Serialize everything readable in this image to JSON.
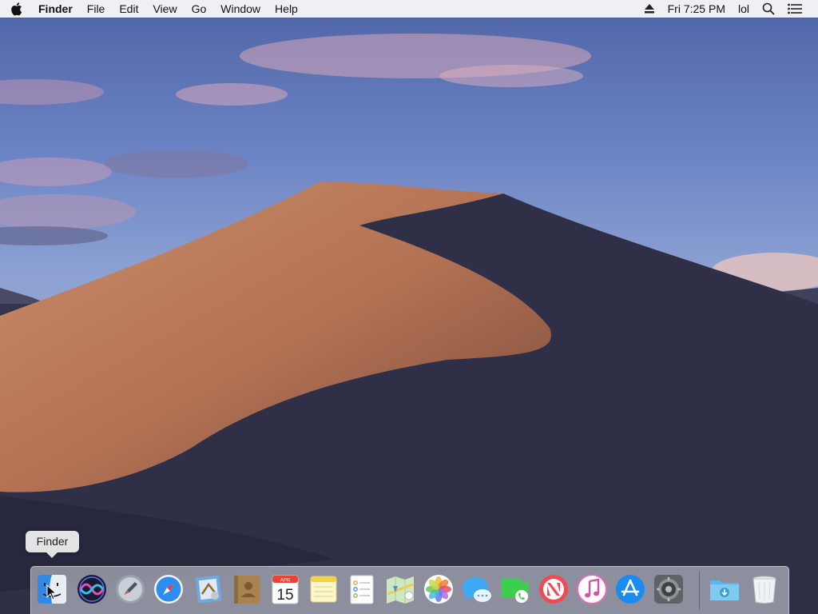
{
  "menubar": {
    "app_name": "Finder",
    "menus": [
      "File",
      "Edit",
      "View",
      "Go",
      "Window",
      "Help"
    ],
    "clock": "Fri 7:25 PM",
    "user": "lol"
  },
  "tooltip": {
    "text": "Finder"
  },
  "calendar": {
    "month": "APR",
    "day": "15"
  },
  "dock": {
    "items": [
      {
        "name": "finder",
        "icon": "finder-icon",
        "running": true
      },
      {
        "name": "siri",
        "icon": "siri-icon"
      },
      {
        "name": "launchpad",
        "icon": "launchpad-icon"
      },
      {
        "name": "safari",
        "icon": "safari-icon"
      },
      {
        "name": "mail",
        "icon": "mail-icon"
      },
      {
        "name": "contacts",
        "icon": "contacts-icon"
      },
      {
        "name": "calendar",
        "icon": "calendar-icon"
      },
      {
        "name": "notes",
        "icon": "notes-icon"
      },
      {
        "name": "reminders",
        "icon": "reminders-icon"
      },
      {
        "name": "maps",
        "icon": "maps-icon"
      },
      {
        "name": "photos",
        "icon": "photos-icon"
      },
      {
        "name": "messages",
        "icon": "messages-icon"
      },
      {
        "name": "facetime",
        "icon": "facetime-icon"
      },
      {
        "name": "news",
        "icon": "news-icon"
      },
      {
        "name": "itunes",
        "icon": "itunes-icon"
      },
      {
        "name": "app-store",
        "icon": "app-store-icon"
      },
      {
        "name": "system-preferences",
        "icon": "system-preferences-icon"
      },
      {
        "name": "downloads",
        "icon": "downloads-folder-icon"
      },
      {
        "name": "trash",
        "icon": "trash-icon"
      }
    ]
  },
  "colors": {
    "menubar": "#f5f5f7",
    "dune_light": "#b9785a",
    "dune_shadow": "#2b2c40",
    "sky_top": "#5b6fae"
  }
}
